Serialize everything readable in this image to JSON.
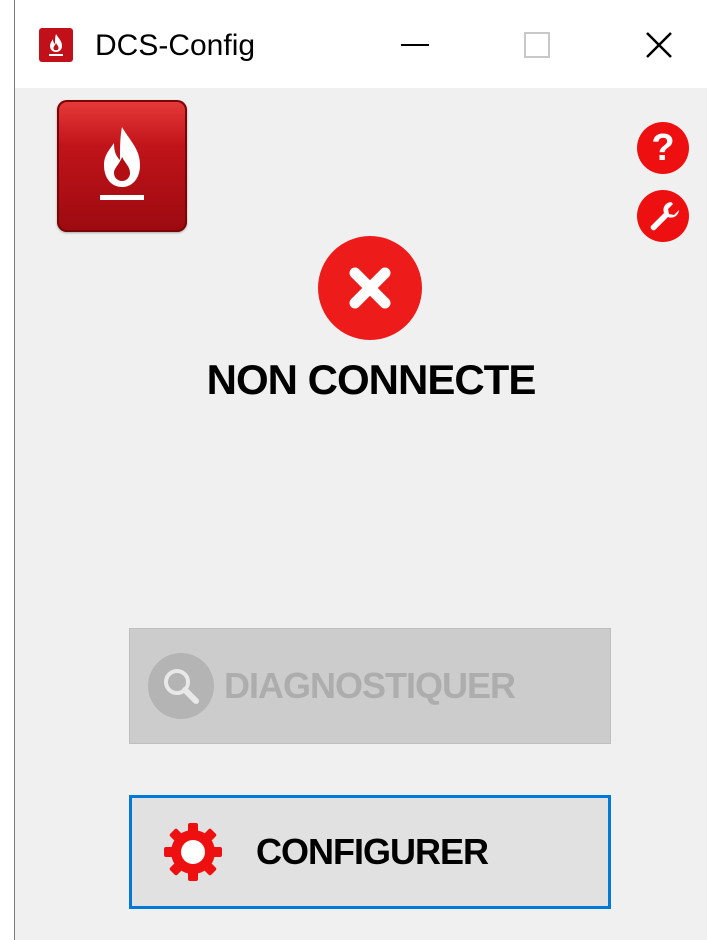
{
  "window": {
    "title": "DCS-Config",
    "icon": "flame-app-icon"
  },
  "titlebar_controls": {
    "minimize": "minimize-icon",
    "maximize": "maximize-icon",
    "close": "✕"
  },
  "toolbar": {
    "help_icon": "help-icon",
    "settings_icon": "wrench-icon"
  },
  "status": {
    "icon": "error-x-icon",
    "text": "NON CONNECTE",
    "color": "#ee1b1b"
  },
  "buttons": {
    "diagnose": {
      "label": "DIAGNOSTIQUER",
      "icon": "magnifier-icon",
      "enabled": false
    },
    "configure": {
      "label": "CONFIGURER",
      "icon": "gear-icon",
      "enabled": true
    }
  },
  "colors": {
    "brand_red": "#c2101a",
    "accent_red": "#ee1010",
    "focus_blue": "#0078d7",
    "disabled_text": "#adadad"
  }
}
